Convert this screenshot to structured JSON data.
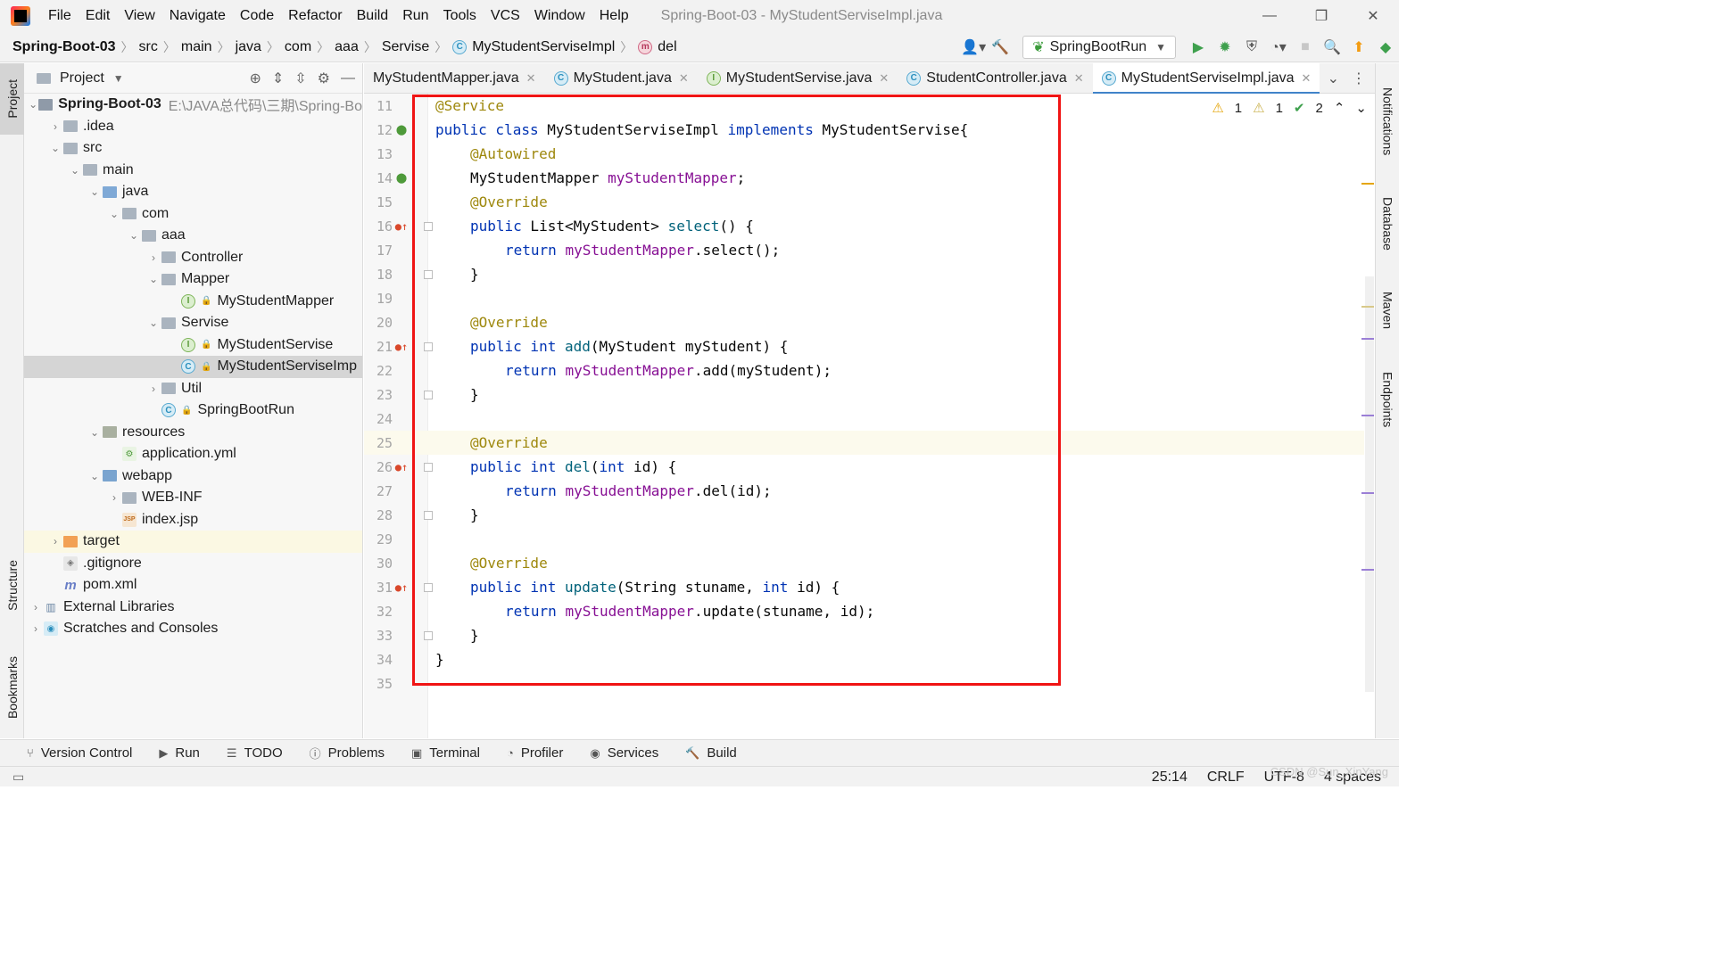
{
  "menubar": {
    "items": [
      "File",
      "Edit",
      "View",
      "Navigate",
      "Code",
      "Refactor",
      "Build",
      "Run",
      "Tools",
      "VCS",
      "Window",
      "Help"
    ],
    "title": "Spring-Boot-03 - MyStudentServiseImpl.java",
    "minimize": "—",
    "restore": "❐",
    "close": "✕"
  },
  "breadcrumb": {
    "items": [
      "Spring-Boot-03",
      "src",
      "main",
      "java",
      "com",
      "aaa",
      "Servise",
      "MyStudentServiseImpl",
      "del"
    ],
    "sep": "〉"
  },
  "toolbar": {
    "run_config": "SpringBootRun"
  },
  "left_strip": {
    "project": "Project",
    "structure": "Structure",
    "bookmarks": "Bookmarks"
  },
  "right_strip": {
    "notifications": "Notifications",
    "database": "Database",
    "maven": "Maven",
    "endpoints": "Endpoints"
  },
  "project_panel": {
    "title": "Project",
    "root_name": "Spring-Boot-03",
    "root_path": "E:\\JAVA总代码\\三期\\Spring-Bo",
    "nodes": {
      "idea": ".idea",
      "src": "src",
      "main": "main",
      "java": "java",
      "com": "com",
      "aaa": "aaa",
      "controller": "Controller",
      "mapper": "Mapper",
      "my_student_mapper": "MyStudentMapper",
      "servise": "Servise",
      "my_student_servise": "MyStudentServise",
      "my_student_servise_impl": "MyStudentServiseImp",
      "util": "Util",
      "spring_boot_run": "SpringBootRun",
      "resources": "resources",
      "application_yml": "application.yml",
      "webapp": "webapp",
      "web_inf": "WEB-INF",
      "index_jsp": "index.jsp",
      "target": "target",
      "gitignore": ".gitignore",
      "pom": "pom.xml",
      "external_libraries": "External Libraries",
      "scratches": "Scratches and Consoles"
    }
  },
  "tabs": [
    {
      "label": "MyStudentMapper.java"
    },
    {
      "label": "MyStudent.java"
    },
    {
      "label": "MyStudentServise.java"
    },
    {
      "label": "StudentController.java"
    },
    {
      "label": "MyStudentServiseImpl.java"
    }
  ],
  "inspections": {
    "warnings": "1",
    "weak_warnings": "1",
    "ok": "2"
  },
  "code_lines": {
    "l11": {
      "num": "11",
      "t1": "@Service"
    },
    "l12": {
      "num": "12",
      "t1": "public class",
      "t2": " MyStudentServiseImpl ",
      "t3": "implements",
      "t4": " MyStudentServise{"
    },
    "l13": {
      "num": "13",
      "t1": "@Autowired"
    },
    "l14": {
      "num": "14",
      "t1": "MyStudentMapper ",
      "t2": "myStudentMapper",
      "t3": ";"
    },
    "l15": {
      "num": "15",
      "t1": "@Override"
    },
    "l16": {
      "num": "16",
      "t1": "public",
      "t2": " List<MyStudent> ",
      "t3": "select",
      "t4": "() {"
    },
    "l17": {
      "num": "17",
      "t1": "return ",
      "t2": "myStudentMapper",
      "t3": ".select();"
    },
    "l18": {
      "num": "18",
      "t1": "}"
    },
    "l19": {
      "num": "19"
    },
    "l20": {
      "num": "20",
      "t1": "@Override"
    },
    "l21": {
      "num": "21",
      "t1": "public int ",
      "t2": "add",
      "t3": "(MyStudent myStudent) {"
    },
    "l22": {
      "num": "22",
      "t1": "return ",
      "t2": "myStudentMapper",
      "t3": ".add(myStudent);"
    },
    "l23": {
      "num": "23",
      "t1": "}"
    },
    "l24": {
      "num": "24"
    },
    "l25": {
      "num": "25",
      "t1": "@Override"
    },
    "l26": {
      "num": "26",
      "t1": "public int ",
      "t2": "del",
      "t3": "(",
      "t4": "int",
      "t5": " id) {"
    },
    "l27": {
      "num": "27",
      "t1": "return ",
      "t2": "myStudentMapper",
      "t3": ".del(id);"
    },
    "l28": {
      "num": "28",
      "t1": "}"
    },
    "l29": {
      "num": "29"
    },
    "l30": {
      "num": "30",
      "t1": "@Override"
    },
    "l31": {
      "num": "31",
      "t1": "public int ",
      "t2": "update",
      "t3": "(String stuname, ",
      "t4": "int",
      "t5": " id) {"
    },
    "l32": {
      "num": "32",
      "t1": "return ",
      "t2": "myStudentMapper",
      "t3": ".update(stuname, id);"
    },
    "l33": {
      "num": "33",
      "t1": "}"
    },
    "l34": {
      "num": "34",
      "t1": "}"
    },
    "l35": {
      "num": "35"
    }
  },
  "bottom_tools": [
    "Version Control",
    "Run",
    "TODO",
    "Problems",
    "Terminal",
    "Profiler",
    "Services",
    "Build"
  ],
  "status": {
    "position": "25:14",
    "line_sep": "CRLF",
    "encoding": "UTF-8",
    "indent": "4 spaces"
  },
  "watermark": "CSDN @Sun_XinYang",
  "colors": {
    "accent": "#4083c9",
    "highlight_box": "#f01414",
    "keyword": "#0033b3",
    "annotation": "#9e880d",
    "field": "#871094",
    "method": "#00627a"
  }
}
